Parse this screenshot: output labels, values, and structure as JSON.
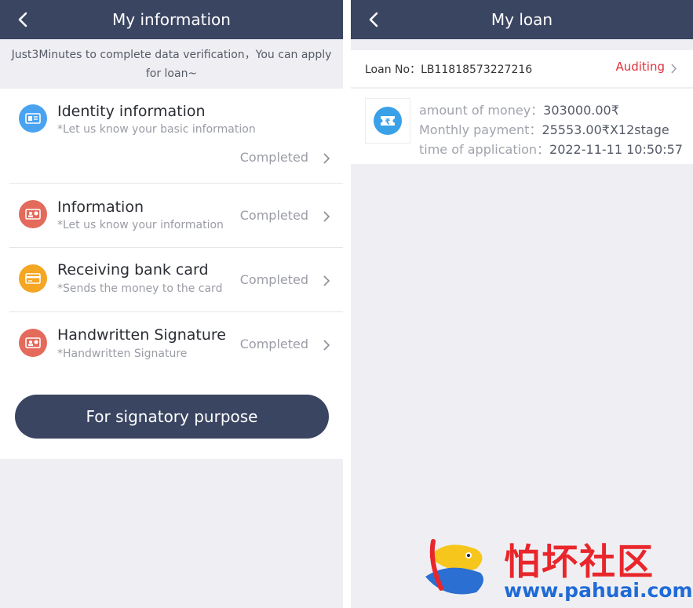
{
  "left": {
    "title": "My information",
    "notice": "Just3Minutes to complete data verification，You can apply for loan~",
    "items": [
      {
        "title": "Identity information",
        "sub": "*Let us know your basic information",
        "status": "Completed",
        "color": "#4aa3f0"
      },
      {
        "title": "Information",
        "sub": "*Let us know your information",
        "status": "Completed",
        "color": "#e46a5c"
      },
      {
        "title": "Receiving bank card",
        "sub": "*Sends the money to the card",
        "status": "Completed",
        "color": "#f5a623"
      },
      {
        "title": "Handwritten Signature",
        "sub": "*Handwritten Signature",
        "status": "Completed",
        "color": "#e46a5c"
      }
    ],
    "button": "For signatory purpose"
  },
  "right": {
    "title": "My loan",
    "loan_no_label": "Loan No：",
    "loan_no": "LB11818573227216",
    "status": "Auditing",
    "amount_label": "amount of money：",
    "amount": "303000.00₹",
    "monthly_label": "Monthly payment：",
    "monthly": "25553.00₹X12stage",
    "time_label": "time of application：",
    "time": "2022-11-11 10:50:57"
  },
  "watermark": {
    "chinese": "怕坏社区",
    "url": "www.pahuai.com"
  },
  "colors": {
    "navbar": "#3a4562",
    "accent_red": "#e0313b",
    "background": "#efeff3"
  }
}
